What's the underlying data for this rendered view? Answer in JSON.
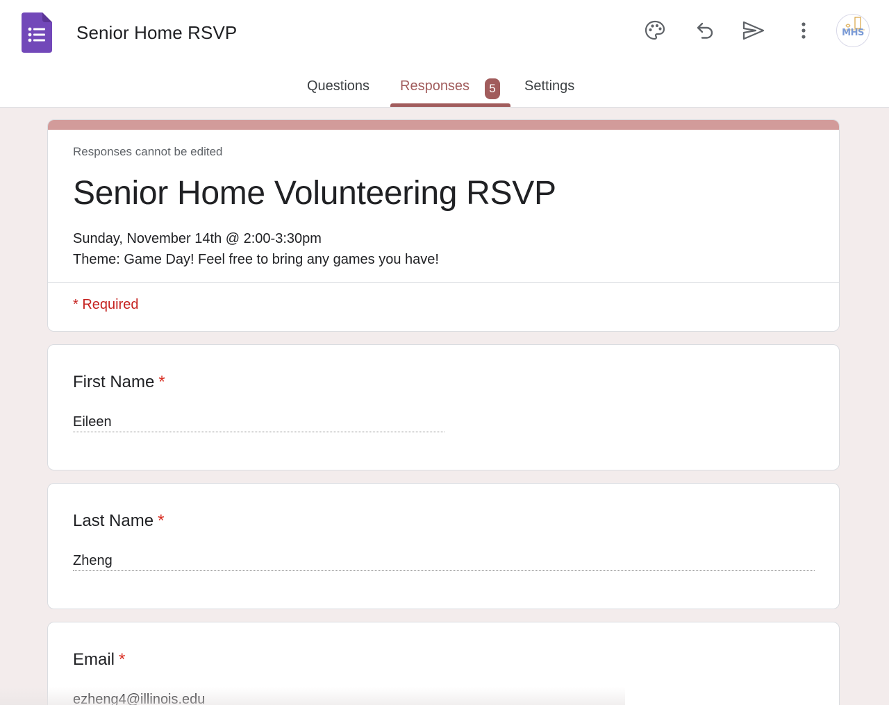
{
  "app": {
    "title": "Senior Home RSVP",
    "logo_icon": "google-forms-icon",
    "accent_color": "#a15c5c"
  },
  "toolbar": {
    "icons": [
      "palette-icon",
      "undo-icon",
      "send-icon",
      "more-vert-icon"
    ],
    "avatar_text": "MHS"
  },
  "tabs": {
    "questions": "Questions",
    "responses": "Responses",
    "responses_count": "5",
    "settings": "Settings",
    "active": "Responses"
  },
  "form": {
    "note": "Responses cannot be edited",
    "title": "Senior Home Volunteering RSVP",
    "description": [
      "Sunday, November 14th @ 2:00-3:30pm",
      "Theme: Game Day! Feel free to bring any games you have!"
    ],
    "required_note": "* Required"
  },
  "questions": [
    {
      "label": "First Name",
      "required_mark": "*",
      "answer": "Eileen"
    },
    {
      "label": "Last Name",
      "required_mark": "*",
      "answer": "Zheng"
    },
    {
      "label": "Email",
      "required_mark": "*",
      "answer": "ezheng4@illinois.edu"
    }
  ]
}
